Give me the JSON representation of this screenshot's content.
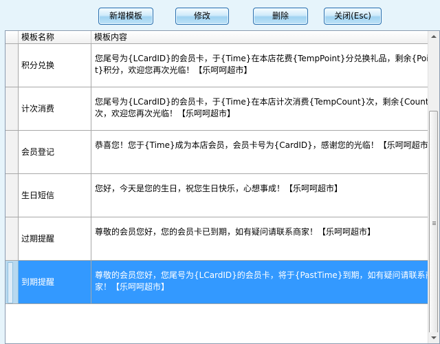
{
  "toolbar": {
    "add_label": "新增模板",
    "edit_label": "修改",
    "delete_label": "删除",
    "close_label": "关闭(Esc)"
  },
  "table": {
    "columns": [
      "模板名称",
      "模板内容"
    ],
    "rows": [
      {
        "name": "积分兑换",
        "content": "您尾号为{LCardID}的会员卡，于{Time}在本店花费{TempPoint}分兑换礼品，剩余{Point}积分，欢迎您再次光临！【乐呵呵超市】"
      },
      {
        "name": "计次消费",
        "content": "您尾号为{LCardID}的会员卡，于{Time}在本店计次消费{TempCount}次，剩余{Count}次，欢迎您再次光临！【乐呵呵超市】"
      },
      {
        "name": "会员登记",
        "content": "恭喜您！您于{Time}成为本店会员，会员卡号为{CardID}，感谢您的光临！【乐呵呵超市】"
      },
      {
        "name": "生日短信",
        "content": "您好，今天是您的生日，祝您生日快乐，心想事成！【乐呵呵超市】"
      },
      {
        "name": "过期提醒",
        "content": "尊敬的会员您好，您的会员卡已到期，如有疑问请联系商家！【乐呵呵超市】"
      },
      {
        "name": "到期提醒",
        "content": "尊敬的会员您好，您尾号为{LCardID}的会员卡，将于{PastTime}到期，如有疑问请联系商家！【乐呵呵超市】"
      }
    ],
    "selected_index": 5
  },
  "colors": {
    "background": "#e6f4fb",
    "selection": "#3399ff",
    "button_border": "#2a6fae"
  }
}
